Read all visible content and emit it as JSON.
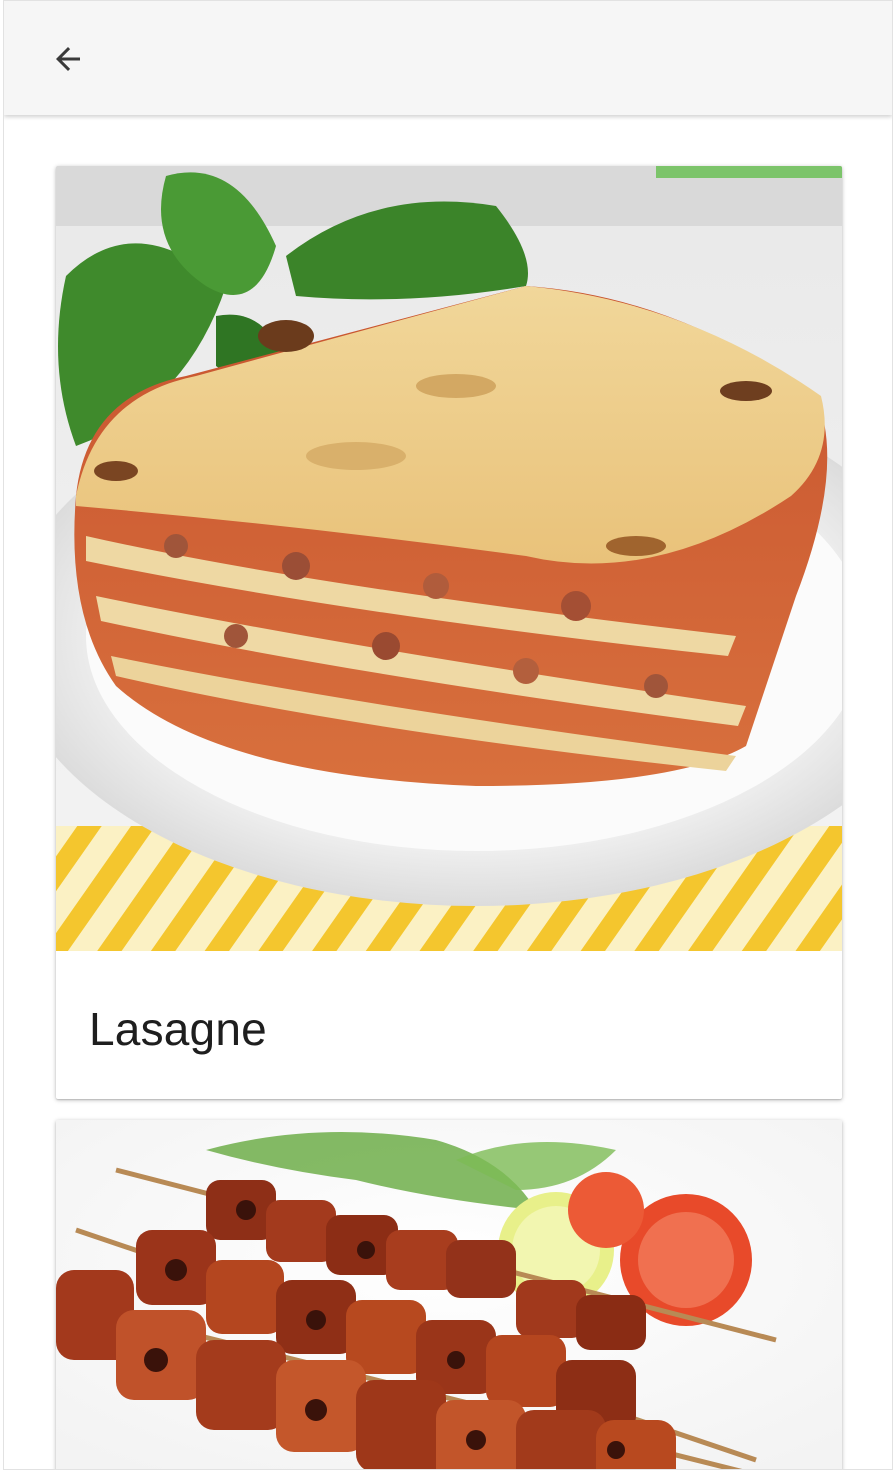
{
  "header": {
    "back_icon": "arrow-back-icon"
  },
  "recipes": [
    {
      "title": "Lasagne",
      "image": "lasagne-photo"
    },
    {
      "title": "",
      "image": "kebab-skewers-photo"
    }
  ]
}
